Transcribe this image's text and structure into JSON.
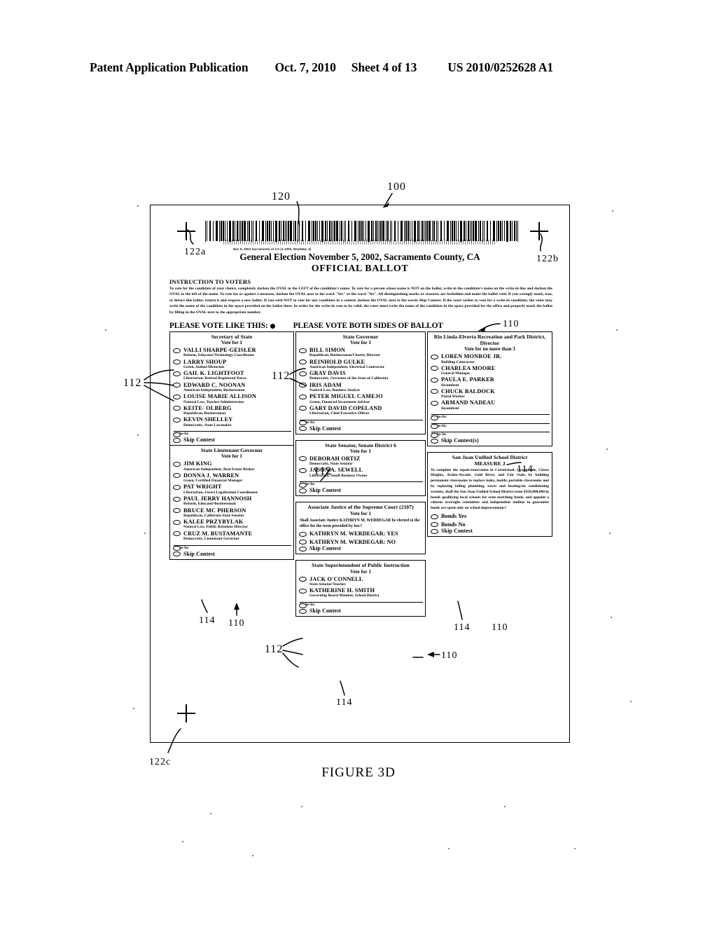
{
  "patent_header": {
    "publication": "Patent Application Publication",
    "date": "Oct. 7, 2010",
    "sheet": "Sheet 4 of 13",
    "number": "US 2010/0252628 A1"
  },
  "figure": {
    "caption": "FIGURE 3D"
  },
  "reference_numerals": {
    "ballot": "100",
    "barcode": "120",
    "contest_box": "110",
    "vote_target": "112",
    "skip_contest": "114",
    "reg_mark_a": "122a",
    "reg_mark_b": "122b",
    "reg_mark_c": "122c",
    "contest_box_2": "110",
    "contest_box_3": "110",
    "contest_box_4": "110",
    "vote_target_2": "112",
    "vote_target_3": "112",
    "vote_target_4": "112",
    "skip_contest_2": "114",
    "skip_contest_3": "114",
    "skip_contest_4": "114"
  },
  "ballot": {
    "microprint": "Nov 5, 2002   Sacramento of CA (1-1000, M115454, 4)",
    "election_title": "General Election November 5, 2002, Sacramento County, CA",
    "official_title": "OFFICIAL BALLOT",
    "instruction_heading": "INSTRUCTION TO VOTERS",
    "instruction_body": "To vote for the candidate of your choice, completely darken the OVAL to the LEFT of the candidate's name.  To vote for a person whose name is NOT on the ballot, write in the candidate's name on the write-in line and darken the OVAL to the left of the name. To vote for or against a measure, darken the OVAL next to the word \"Yes\" or the word \"No\". All distinguishing marks or erasures are forbidden and make the ballot void. If you wrongly mark, tear, or deface this ballot, return it and request a new ballot.  If you wish NOT to vote for any candidate in a contest, darken the OVAL next to the words Skip Contest. If the voter wishes to vote for a write-in candidate, the voter may write the name of the candidate in the space provided on the ballot sheet. In order for the write-in vote to be valid, the voter must write the name of the candidate in the  space provided for the office and properly mark the ballot by filling in the OVAL next to the appropriate number.",
    "vote_like_this": "PLEASE VOTE LIKE THIS:",
    "vote_both_sides": "PLEASE VOTE BOTH SIDES OF BALLOT",
    "write_in_label": "Write-In:",
    "skip_contest_label": "Skip Contest",
    "skip_contests_label": "Skip Contest(s)"
  },
  "contests": [
    {
      "id": "secretary-of-state",
      "title": "Secretary of State",
      "instruction": "Vote for 1",
      "candidates": [
        {
          "name": "VALLI  SHARPE-GEISLER",
          "desc": "Reform, Educator/Technology Coordinator"
        },
        {
          "name": "LARRY  SHOUP",
          "desc": "Green, Author/Historian"
        },
        {
          "name": "GAIL K. LIGHTFOOT",
          "desc": "Libertarian, Retired Registered Nurse"
        },
        {
          "name": "EDWARD C. NOONAN",
          "desc": "American Independent, Businessman"
        },
        {
          "name": "LOUISE MARIE ALLISON",
          "desc": "Natural Law, Teacher/Administrator"
        },
        {
          "name": "KEITE· OLBERG",
          "desc": "Republican, Businessman"
        },
        {
          "name": "KEVIN  SHELLEY",
          "desc": "Democratic, State Lawmaker"
        }
      ],
      "write_ins": 1,
      "skip_label": "Skip Contest"
    },
    {
      "id": "state-lieutenant-governor",
      "title": "State Lieutenant Governor",
      "instruction": "Vote for 1",
      "candidates": [
        {
          "name": "JIM  KING",
          "desc": "American Independent, Real Estate Broker"
        },
        {
          "name": "DONNA J. WARREN",
          "desc": "Green, Certified Financial Manager"
        },
        {
          "name": "PAT  WRIGHT",
          "desc": "Libertarian, Forest Legalization Coordinator"
        },
        {
          "name": "PAUL JERRY HANNOSH",
          "desc": "Reform, Educator/Businessman"
        },
        {
          "name": "BRUCE  MC PHERSON",
          "desc": "Republican, California State Senator"
        },
        {
          "name": "KALEE  PRZYBYLAK",
          "desc": "Natural Law, Public Relations Director"
        },
        {
          "name": "CRUZ M. BUSTAMANTE",
          "desc": "Democratic, Lieutenant Governor"
        }
      ],
      "write_ins": 1,
      "skip_label": "Skip Contest"
    },
    {
      "id": "state-governor",
      "title": "State Governor",
      "instruction": "Vote for 1",
      "candidates": [
        {
          "name": "BILL  SIMON",
          "desc": "Republican, Businessman/Charity Director"
        },
        {
          "name": "REINHOLD  GULKE",
          "desc": "American Independent, Electrical Contractor"
        },
        {
          "name": "GRAY  DAVIS",
          "desc": "Democratic, Governor of the State of California"
        },
        {
          "name": "IRIS  ADAM",
          "desc": "Natural Law, Business Analyst"
        },
        {
          "name": "PETER MIGUEL  CAMEJO",
          "desc": "Green, Financial Investment Adviser"
        },
        {
          "name": "GARY DAVID COPELAND",
          "desc": "Libertarian, Chief Executive Officer"
        }
      ],
      "write_ins": 1,
      "skip_label": "Skip Contest"
    },
    {
      "id": "state-senator-district-6",
      "title": "State Senator, Senate District 6",
      "instruction": "Vote for 1",
      "candidates": [
        {
          "name": "DEBORAH  ORTIZ",
          "desc": "Democratic, State Senator"
        },
        {
          "name": "JASON A. SEWELL",
          "desc": "Libertarian, Small Business Owner"
        }
      ],
      "write_ins": 1,
      "skip_label": "Skip Contest"
    },
    {
      "id": "associate-justice-supreme-court",
      "title": "Associate Justice of the Supreme Court (2107)",
      "instruction": "Vote for 1",
      "question": "Shall Associate Justice KATHRYN M. WERDEGAR be elected to the office for the term provided by law?",
      "options": [
        {
          "label": "KATHRYN M. WERDEGAR: YES"
        },
        {
          "label": "KATHRYN M. WERDEGAR: NO"
        }
      ],
      "skip_label": "Skip Contest"
    },
    {
      "id": "state-superintendent-public-instruction",
      "title": "State Superintendent of Public Instruction",
      "instruction": "Vote for 1",
      "candidates": [
        {
          "name": "JACK  O'CONNELL",
          "desc": "State Senator/Teacher"
        },
        {
          "name": "KATHERINE H. SMITH",
          "desc": "Governing Board Member, School District"
        }
      ],
      "write_ins": 1,
      "skip_label": "Skip Contest"
    },
    {
      "id": "rio-linda-elverta-park-district-director",
      "title": "Rio Linda-Elverta Recreation and Park District, Director",
      "instruction": "Vote for no more than 3",
      "candidates": [
        {
          "name": "LOREN  MONROE JR.",
          "desc": "Building Contractor"
        },
        {
          "name": "CHARLEA  MOORE",
          "desc": "General Manager"
        },
        {
          "name": "PAULA E. PARKER",
          "desc": "Incumbent"
        },
        {
          "name": "CHUCK  BALDOCK",
          "desc": "Postal Worker"
        },
        {
          "name": "ARMAND  NADEAU",
          "desc": "Incumbent"
        }
      ],
      "write_ins": 3,
      "skip_label": "Skip Contest(s)"
    },
    {
      "id": "san-juan-unified-school-district-measure-j",
      "title": "San Juan Unified School District",
      "measure_name": "MEASURE J",
      "measure_text": "To complete the repair/renovation in Carmichael, Orangevale, Citrus Heights, Arden-Arcade, Gold River, and Fair Oaks by building permanent classrooms to replace leaky, moldy, portable classrooms and by replacing failing plumbing, sewer and heating/air conditioning systems, shall the San Juan Unified School District issue $350,000,000 in bonds qualifying local schools for state matching funds, and appoint a citizens oversight committee and independent auditor to guarantee funds are spent only on school improvements?",
      "options": [
        {
          "label": "Bonds Yes"
        },
        {
          "label": "Bonds No"
        }
      ],
      "skip_label": "Skip Contest"
    }
  ]
}
